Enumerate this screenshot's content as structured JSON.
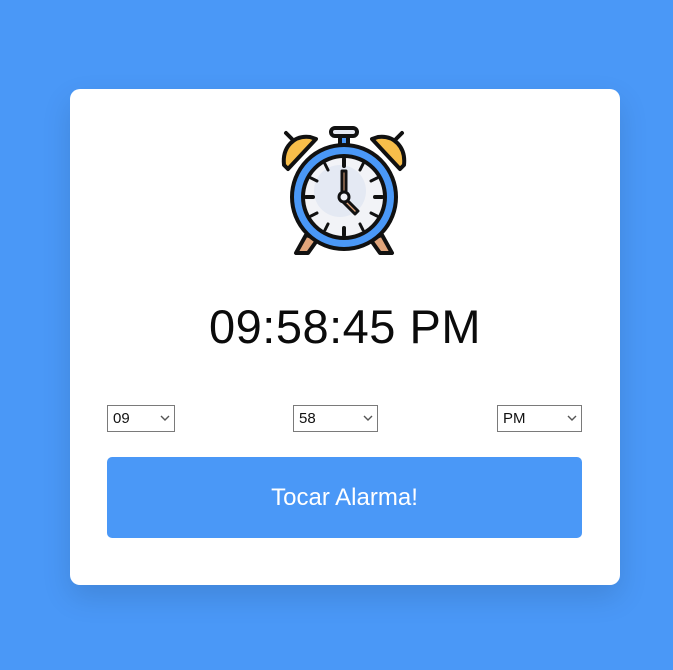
{
  "clock": {
    "time": "09:58:45 PM",
    "icon": "alarm-clock-icon"
  },
  "selects": {
    "hour": "09",
    "minute": "58",
    "ampm": "PM"
  },
  "button": {
    "label": "Tocar Alarma!"
  },
  "colors": {
    "background": "#4a98f7",
    "card": "#ffffff",
    "button": "#4a98f7",
    "clock_ring": "#4a98f7",
    "bells": "#f8be4a"
  }
}
